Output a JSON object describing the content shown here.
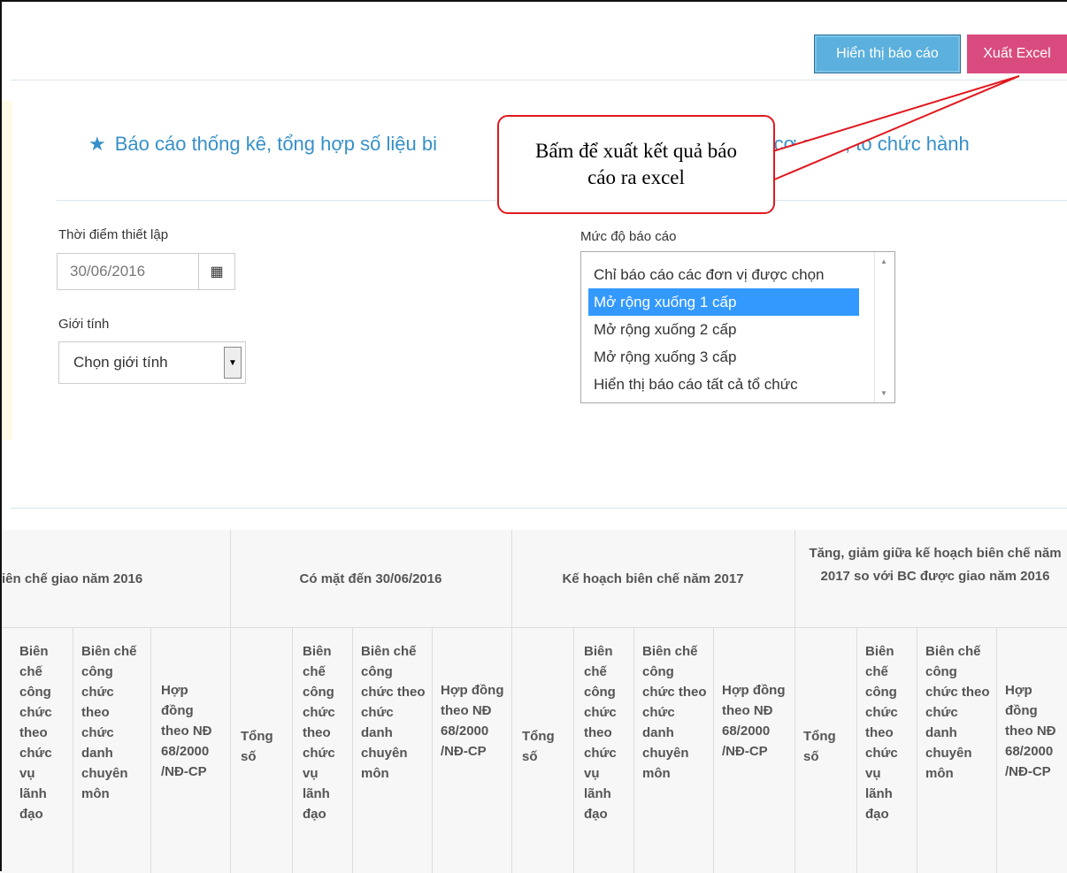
{
  "toolbar": {
    "show_report_label": "Hiển thị báo cáo",
    "export_excel_label": "Xuất Excel"
  },
  "page": {
    "title": "Báo cáo thống kê, tổng hợp số liệu bi",
    "title_tail": "ng cơ quản, tổ chức hành"
  },
  "callout": {
    "line1": "Bấm để xuất kết quả báo",
    "line2": "cáo ra excel"
  },
  "form": {
    "date_label": "Thời điểm thiết lập",
    "date_value": "30/06/2016",
    "gender_label": "Giới tính",
    "gender_value": "Chọn giới tính",
    "level_label": "Mức độ báo cáo",
    "level_options": [
      "Chỉ báo cáo các đơn vị được chọn",
      "Mở rộng xuống 1 cấp",
      "Mở rộng xuống 2 cấp",
      "Mở rộng xuống 3 cấp",
      "Hiển thị báo cáo tất cả tổ chức"
    ],
    "level_selected": "Mở rộng xuống 1 cấp"
  },
  "table": {
    "groups": [
      "iên chế giao năm 2016",
      "Có mặt đến 30/06/2016",
      "Kế hoạch biên chế năm 2017",
      "Tăng, giảm giữa kế hoạch biên chế năm 2017 so với BC được giao năm 2016"
    ],
    "sub_tong_so": "Tổng số",
    "sub_lanh_dao": "Biên chế công chức theo chức vụ lãnh đạo",
    "sub_chuyen_mon": "Biên chế công chức theo chức danh chuyên môn",
    "sub_hop_dong": "Hợp đồng theo NĐ 68/2000 /NĐ-CP"
  },
  "colors": {
    "accent": "#3690c8",
    "excel": "#d94b7e",
    "show": "#5bb0dd",
    "selected": "#3399ff",
    "callout_border": "#e0191f"
  }
}
